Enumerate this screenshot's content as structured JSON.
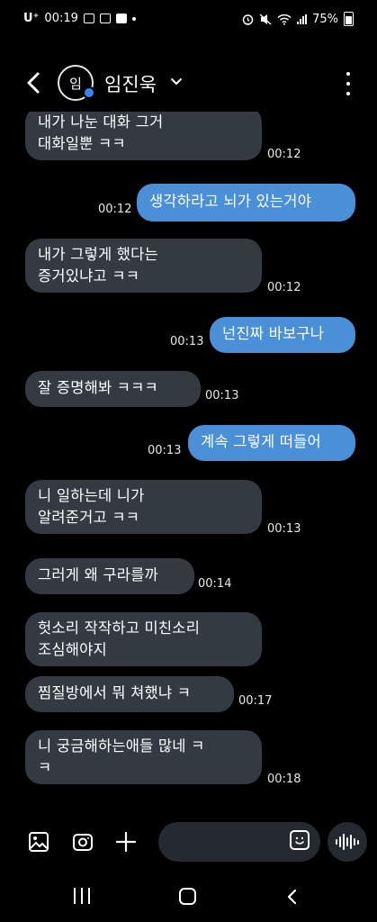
{
  "status_bar": {
    "carrier": "U⁺",
    "time": "00:19",
    "battery": "75%"
  },
  "header": {
    "avatar_initial": "임",
    "contact_name": "임진욱"
  },
  "messages": [
    {
      "side": "in",
      "lines": [
        "내가 나눈 대화 그거",
        "대화일뿐 ㅋㅋ"
      ],
      "time": "00:12"
    },
    {
      "side": "out",
      "lines": [
        "생각하라고 뇌가 있는거야"
      ],
      "time": "00:12"
    },
    {
      "side": "in",
      "lines": [
        "내가 그렇게 했다는",
        "증거있냐고 ㅋㅋ"
      ],
      "time": "00:12"
    },
    {
      "side": "out",
      "lines": [
        "넌진짜 바보구나"
      ],
      "time": "00:13"
    },
    {
      "side": "in",
      "lines": [
        "잘 증명해봐 ㅋㅋㅋ"
      ],
      "time": "00:13"
    },
    {
      "side": "out",
      "lines": [
        "계속 그렇게 떠들어"
      ],
      "time": "00:13"
    },
    {
      "side": "in",
      "lines": [
        "니 일하는데 니가",
        "알려준거고 ㅋㅋ"
      ],
      "time": "00:13"
    },
    {
      "side": "in",
      "lines": [
        "그러게 왜 구라를까"
      ],
      "time": "00:14"
    },
    {
      "side": "in",
      "lines": [
        "헛소리 작작하고 미친소리",
        "조심해야지"
      ],
      "time": ""
    },
    {
      "side": "in",
      "lines": [
        "찜질방에서 뭐 쳐했냐 ㅋ"
      ],
      "time": "00:17"
    },
    {
      "side": "in",
      "lines": [
        "니 궁금해하는애들 많네 ㅋ",
        "ㅋ"
      ],
      "time": "00:18"
    }
  ],
  "icons": {
    "back": "arrow-left-icon",
    "more": "more-vertical-icon",
    "gallery": "image-icon",
    "camera": "camera-icon",
    "add": "plus-icon",
    "emoji": "emoji-icon",
    "voice": "voice-wave-icon"
  },
  "colors": {
    "background": "#000000",
    "incoming_bubble": "#333a42",
    "outgoing_bubble": "#4a90d9",
    "presence_dot": "#3b82f6"
  }
}
